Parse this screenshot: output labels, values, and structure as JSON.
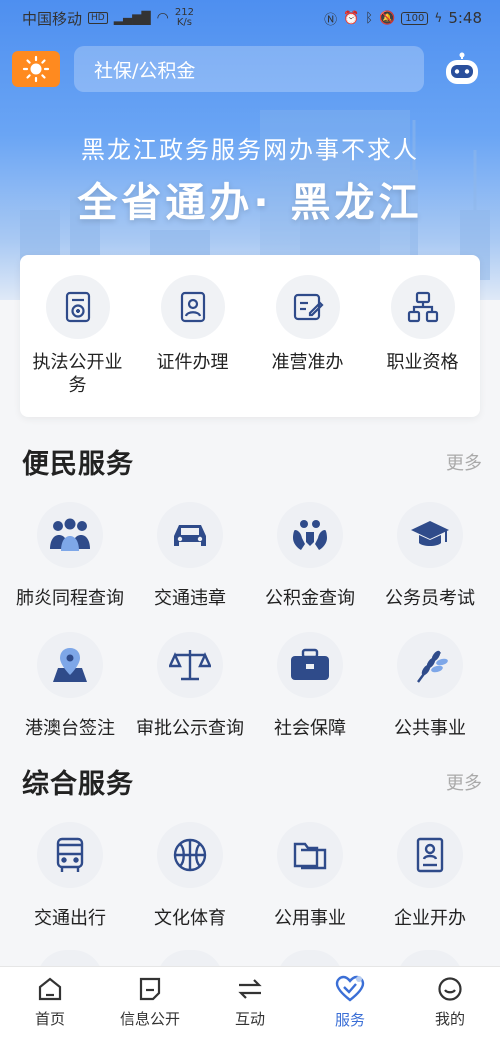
{
  "status_bar": {
    "carrier": "中国移动",
    "hd": "HD",
    "signal": "⁴ᴳ",
    "speed_value": "212",
    "speed_unit": "K/s",
    "battery": "100",
    "time": "5:48"
  },
  "search": {
    "placeholder": "社保/公积金"
  },
  "hero": {
    "subtitle": "黑龙江政务服务网办事不求人",
    "title": "全省通办· 黑龙江"
  },
  "quick_items": [
    {
      "label": "执法公开业务",
      "icon": "law-document-icon"
    },
    {
      "label": "证件办理",
      "icon": "id-card-icon"
    },
    {
      "label": "准营准办",
      "icon": "license-edit-icon"
    },
    {
      "label": "职业资格",
      "icon": "org-chart-icon"
    }
  ],
  "convenience": {
    "title": "便民服务",
    "more": "更多",
    "items": [
      {
        "label": "肺炎同程查询",
        "icon": "group-lungs-icon"
      },
      {
        "label": "交通违章",
        "icon": "car-icon"
      },
      {
        "label": "公积金查询",
        "icon": "hands-icon"
      },
      {
        "label": "公务员考试",
        "icon": "graduation-cap-icon"
      },
      {
        "label": "港澳台签注",
        "icon": "map-pin-icon"
      },
      {
        "label": "审批公示查询",
        "icon": "scales-icon"
      },
      {
        "label": "社会保障",
        "icon": "toolbox-icon"
      },
      {
        "label": "公共事业",
        "icon": "wheat-icon"
      }
    ]
  },
  "comprehensive": {
    "title": "综合服务",
    "more": "更多",
    "items": [
      {
        "label": "交通出行",
        "icon": "bus-icon"
      },
      {
        "label": "文化体育",
        "icon": "basketball-icon"
      },
      {
        "label": "公用事业",
        "icon": "folder-icon"
      },
      {
        "label": "企业开办",
        "icon": "certificate-icon"
      }
    ]
  },
  "tabs": [
    {
      "label": "首页",
      "icon": "home-icon",
      "active": false
    },
    {
      "label": "信息公开",
      "icon": "note-icon",
      "active": false
    },
    {
      "label": "互动",
      "icon": "exchange-icon",
      "active": false
    },
    {
      "label": "服务",
      "icon": "heart-check-icon",
      "active": true
    },
    {
      "label": "我的",
      "icon": "smile-icon",
      "active": false
    }
  ],
  "colors": {
    "accent": "#3b6fd6",
    "icon_blue": "#2f4b8a",
    "weather_orange": "#ff8a1f"
  }
}
